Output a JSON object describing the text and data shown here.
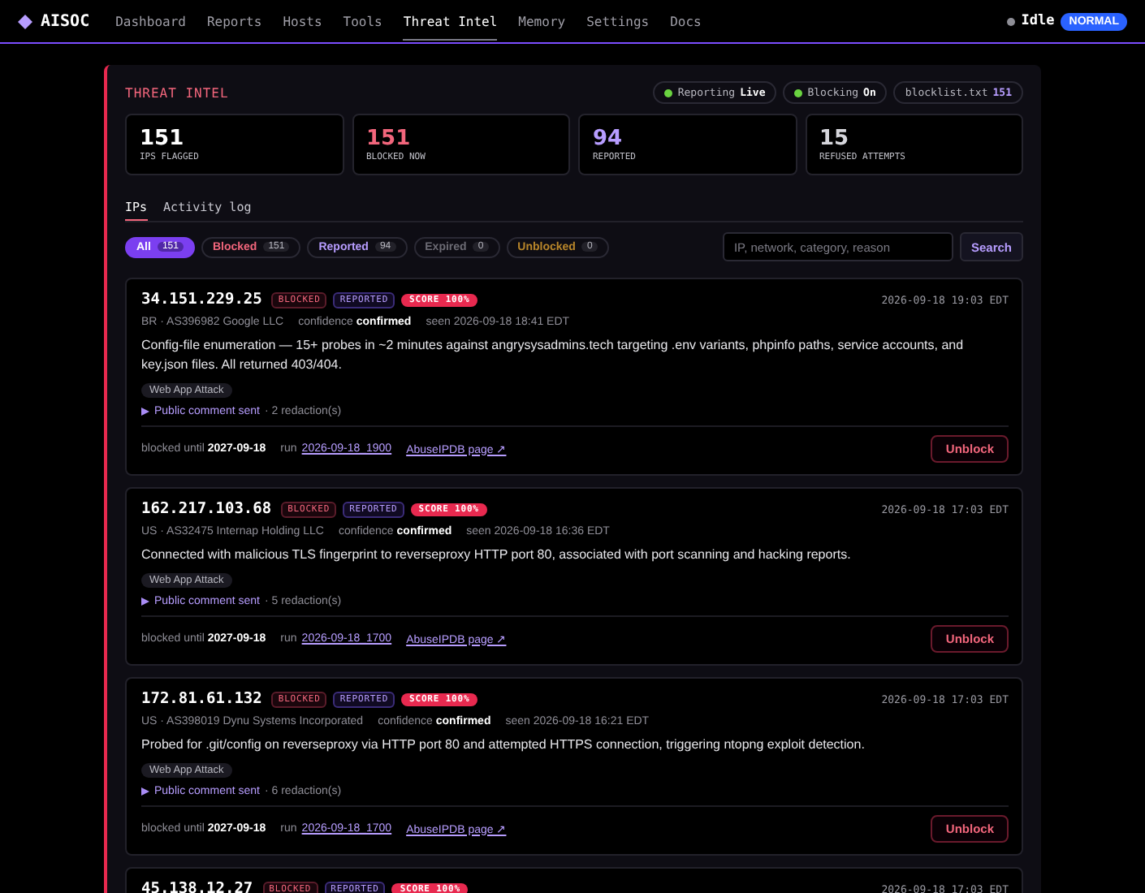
{
  "nav": {
    "brand": "AISOC",
    "items": [
      {
        "label": "Dashboard",
        "selected": false
      },
      {
        "label": "Reports",
        "selected": false
      },
      {
        "label": "Hosts",
        "selected": false
      },
      {
        "label": "Tools",
        "selected": false
      },
      {
        "label": "Threat Intel",
        "selected": true
      },
      {
        "label": "Memory",
        "selected": false
      },
      {
        "label": "Settings",
        "selected": false
      },
      {
        "label": "Docs",
        "selected": false
      }
    ],
    "status": {
      "label": "Idle",
      "badge": "NORMAL"
    }
  },
  "panel": {
    "title": "THREAT INTEL",
    "pills": [
      {
        "kind": "toggle",
        "label": "Reporting",
        "value": "Live",
        "on": true
      },
      {
        "kind": "toggle",
        "label": "Blocking",
        "value": "On",
        "on": true
      },
      {
        "kind": "file",
        "label": "blocklist.txt",
        "value": "151"
      }
    ],
    "stats": [
      {
        "value": "151",
        "label": "IPS FLAGGED",
        "color": "#ffffff"
      },
      {
        "value": "151",
        "label": "BLOCKED NOW",
        "color": "#f2667c"
      },
      {
        "value": "94",
        "label": "REPORTED",
        "color": "#b79dff"
      },
      {
        "value": "15",
        "label": "REFUSED ATTEMPTS",
        "color": "#d6d6dc"
      }
    ],
    "tabs": [
      {
        "label": "IPs",
        "selected": true
      },
      {
        "label": "Activity log",
        "selected": false
      }
    ],
    "filters": [
      {
        "label": "All",
        "count": "151",
        "selected": true,
        "color": "#ffffff"
      },
      {
        "label": "Blocked",
        "count": "151",
        "selected": false,
        "color": "#f2667c"
      },
      {
        "label": "Reported",
        "count": "94",
        "selected": false,
        "color": "#b79dff"
      },
      {
        "label": "Expired",
        "count": "0",
        "selected": false,
        "color": "#6c6b74"
      },
      {
        "label": "Unblocked",
        "count": "0",
        "selected": false,
        "color": "#b8862a"
      }
    ],
    "search": {
      "placeholder": "IP, network, category, reason",
      "button": "Search"
    },
    "entries": [
      {
        "ip": "34.151.229.25",
        "badges": [
          {
            "kind": "blocked",
            "label": "BLOCKED"
          },
          {
            "kind": "reported",
            "label": "REPORTED"
          },
          {
            "kind": "score",
            "label": "SCORE 100%"
          }
        ],
        "time": "2026-09-18 19:03 EDT",
        "origin": "BR · AS396982 Google LLC",
        "confidence_label": "confidence",
        "confidence": "confirmed",
        "seen": "seen 2026-09-18 18:41 EDT",
        "description": "Config-file enumeration — 15+ probes in ~2 minutes against angrysysadmins.tech targeting .env variants, phpinfo paths, service accounts, and key.json files. All returned 403/404.",
        "tags": [
          "Web App Attack"
        ],
        "comment": "Public comment sent",
        "comment_detail": "· 2 redaction(s)",
        "blocked_label": "blocked until",
        "blocked_until": "2027-09-18",
        "run_label": "run",
        "run": "2026-09-18_1900",
        "link": "AbuseIPDB page ↗",
        "action": "Unblock"
      },
      {
        "ip": "162.217.103.68",
        "badges": [
          {
            "kind": "blocked",
            "label": "BLOCKED"
          },
          {
            "kind": "reported",
            "label": "REPORTED"
          },
          {
            "kind": "score",
            "label": "SCORE 100%"
          }
        ],
        "time": "2026-09-18 17:03 EDT",
        "origin": "US · AS32475 Internap Holding LLC",
        "confidence_label": "confidence",
        "confidence": "confirmed",
        "seen": "seen 2026-09-18 16:36 EDT",
        "description": "Connected with malicious TLS fingerprint to reverseproxy HTTP port 80, associated with port scanning and hacking reports.",
        "tags": [
          "Web App Attack"
        ],
        "comment": "Public comment sent",
        "comment_detail": "· 5 redaction(s)",
        "blocked_label": "blocked until",
        "blocked_until": "2027-09-18",
        "run_label": "run",
        "run": "2026-09-18_1700",
        "link": "AbuseIPDB page ↗",
        "action": "Unblock"
      },
      {
        "ip": "172.81.61.132",
        "badges": [
          {
            "kind": "blocked",
            "label": "BLOCKED"
          },
          {
            "kind": "reported",
            "label": "REPORTED"
          },
          {
            "kind": "score",
            "label": "SCORE 100%"
          }
        ],
        "time": "2026-09-18 17:03 EDT",
        "origin": "US · AS398019 Dynu Systems Incorporated",
        "confidence_label": "confidence",
        "confidence": "confirmed",
        "seen": "seen 2026-09-18 16:21 EDT",
        "description": "Probed for .git/config on reverseproxy via HTTP port 80 and attempted HTTPS connection, triggering ntopng exploit detection.",
        "tags": [
          "Web App Attack"
        ],
        "comment": "Public comment sent",
        "comment_detail": "· 6 redaction(s)",
        "blocked_label": "blocked until",
        "blocked_until": "2027-09-18",
        "run_label": "run",
        "run": "2026-09-18_1700",
        "link": "AbuseIPDB page ↗",
        "action": "Unblock"
      },
      {
        "ip": "45.138.12.27",
        "badges": [
          {
            "kind": "blocked",
            "label": "BLOCKED"
          },
          {
            "kind": "reported",
            "label": "REPORTED"
          },
          {
            "kind": "score",
            "label": "SCORE 100%"
          }
        ],
        "time": "2026-09-18 17:03 EDT"
      }
    ]
  }
}
